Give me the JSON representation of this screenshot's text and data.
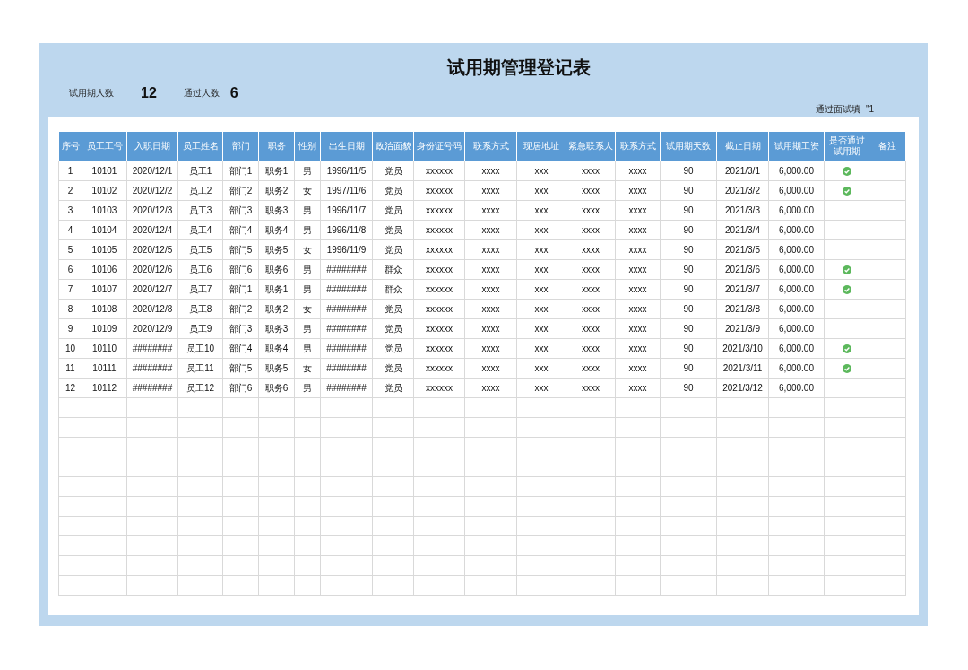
{
  "title": "试用期管理登记表",
  "summary": [
    {
      "label": "试用期人数",
      "value": "12"
    },
    {
      "label": "通过人数",
      "value": "6"
    }
  ],
  "note": "通过面试填  \"1",
  "table": {
    "columns": [
      "序号",
      "员工工号",
      "入职日期",
      "员工姓名",
      "部门",
      "职务",
      "性别",
      "出生日期",
      "政治面貌",
      "身份证号码",
      "联系方式",
      "现居地址",
      "紧急联系人",
      "联系方式",
      "试用期天数",
      "截止日期",
      "试用期工资",
      "是否通过试用期",
      "备注"
    ],
    "rows": [
      {
        "cells": [
          "1",
          "10101",
          "2020/12/1",
          "员工1",
          "部门1",
          "职务1",
          "男",
          "1996/11/5",
          "党员",
          "xxxxxx",
          "xxxx",
          "xxx",
          "xxxx",
          "xxxx",
          "90",
          "2021/3/1",
          "6,000.00"
        ],
        "passed": true
      },
      {
        "cells": [
          "2",
          "10102",
          "2020/12/2",
          "员工2",
          "部门2",
          "职务2",
          "女",
          "1997/11/6",
          "党员",
          "xxxxxx",
          "xxxx",
          "xxx",
          "xxxx",
          "xxxx",
          "90",
          "2021/3/2",
          "6,000.00"
        ],
        "passed": true
      },
      {
        "cells": [
          "3",
          "10103",
          "2020/12/3",
          "员工3",
          "部门3",
          "职务3",
          "男",
          "1996/11/7",
          "党员",
          "xxxxxx",
          "xxxx",
          "xxx",
          "xxxx",
          "xxxx",
          "90",
          "2021/3/3",
          "6,000.00"
        ],
        "passed": false
      },
      {
        "cells": [
          "4",
          "10104",
          "2020/12/4",
          "员工4",
          "部门4",
          "职务4",
          "男",
          "1996/11/8",
          "党员",
          "xxxxxx",
          "xxxx",
          "xxx",
          "xxxx",
          "xxxx",
          "90",
          "2021/3/4",
          "6,000.00"
        ],
        "passed": false
      },
      {
        "cells": [
          "5",
          "10105",
          "2020/12/5",
          "员工5",
          "部门5",
          "职务5",
          "女",
          "1996/11/9",
          "党员",
          "xxxxxx",
          "xxxx",
          "xxx",
          "xxxx",
          "xxxx",
          "90",
          "2021/3/5",
          "6,000.00"
        ],
        "passed": false
      },
      {
        "cells": [
          "6",
          "10106",
          "2020/12/6",
          "员工6",
          "部门6",
          "职务6",
          "男",
          "########",
          "群众",
          "xxxxxx",
          "xxxx",
          "xxx",
          "xxxx",
          "xxxx",
          "90",
          "2021/3/6",
          "6,000.00"
        ],
        "passed": true
      },
      {
        "cells": [
          "7",
          "10107",
          "2020/12/7",
          "员工7",
          "部门1",
          "职务1",
          "男",
          "########",
          "群众",
          "xxxxxx",
          "xxxx",
          "xxx",
          "xxxx",
          "xxxx",
          "90",
          "2021/3/7",
          "6,000.00"
        ],
        "passed": true
      },
      {
        "cells": [
          "8",
          "10108",
          "2020/12/8",
          "员工8",
          "部门2",
          "职务2",
          "女",
          "########",
          "党员",
          "xxxxxx",
          "xxxx",
          "xxx",
          "xxxx",
          "xxxx",
          "90",
          "2021/3/8",
          "6,000.00"
        ],
        "passed": false
      },
      {
        "cells": [
          "9",
          "10109",
          "2020/12/9",
          "员工9",
          "部门3",
          "职务3",
          "男",
          "########",
          "党员",
          "xxxxxx",
          "xxxx",
          "xxx",
          "xxxx",
          "xxxx",
          "90",
          "2021/3/9",
          "6,000.00"
        ],
        "passed": false
      },
      {
        "cells": [
          "10",
          "10110",
          "########",
          "员工10",
          "部门4",
          "职务4",
          "男",
          "########",
          "党员",
          "xxxxxx",
          "xxxx",
          "xxx",
          "xxxx",
          "xxxx",
          "90",
          "2021/3/10",
          "6,000.00"
        ],
        "passed": true
      },
      {
        "cells": [
          "11",
          "10111",
          "########",
          "员工11",
          "部门5",
          "职务5",
          "女",
          "########",
          "党员",
          "xxxxxx",
          "xxxx",
          "xxx",
          "xxxx",
          "xxxx",
          "90",
          "2021/3/11",
          "6,000.00"
        ],
        "passed": true
      },
      {
        "cells": [
          "12",
          "10112",
          "########",
          "员工12",
          "部门6",
          "职务6",
          "男",
          "########",
          "党员",
          "xxxxxx",
          "xxxx",
          "xxx",
          "xxxx",
          "xxxx",
          "90",
          "2021/3/12",
          "6,000.00"
        ],
        "passed": false
      }
    ]
  }
}
